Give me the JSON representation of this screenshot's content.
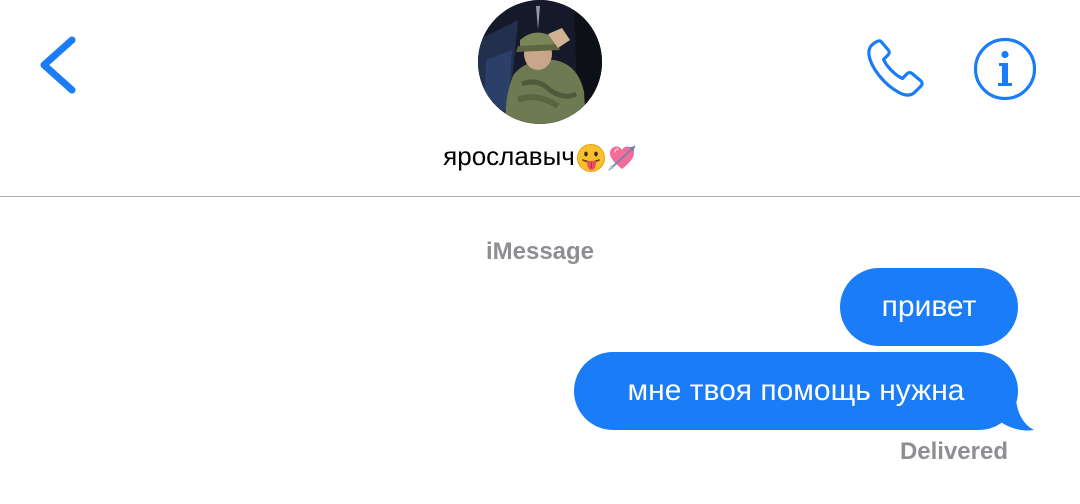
{
  "header": {
    "contact_name": "ярославыч",
    "contact_emojis": [
      "😛",
      "💘"
    ],
    "back_icon": "chevron-left-icon",
    "call_icon": "phone-icon",
    "info_icon": "info-icon"
  },
  "conversation": {
    "service_label": "iMessage",
    "messages": [
      {
        "text": "привет",
        "direction": "outgoing"
      },
      {
        "text": "мне твоя помощь нужна",
        "direction": "outgoing"
      }
    ],
    "status": "Delivered"
  },
  "colors": {
    "accent": "#1a7cf6",
    "meta_text": "#8e8e93",
    "divider": "#b2b2b2"
  }
}
